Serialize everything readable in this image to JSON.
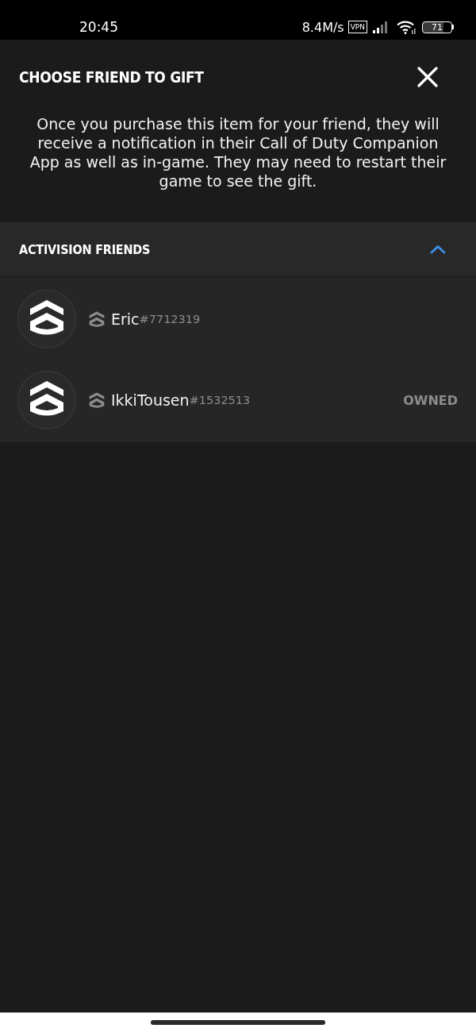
{
  "status_bar": {
    "time": "20:45",
    "network_speed": "8.4M/s",
    "vpn": "VPN",
    "battery": "71"
  },
  "dialog": {
    "title": "CHOOSE FRIEND TO GIFT",
    "description": "Once you purchase this item for your friend, they will receive a notification in their Call of Duty Companion App as well as in-game. They may need to restart their game to see the gift."
  },
  "section": {
    "title": "ACTIVISION FRIENDS",
    "expanded": true,
    "friends": [
      {
        "name": "Eric",
        "tag": "#7712319"
      },
      {
        "name": "IkkiTousen",
        "tag": "#1532513",
        "status": "OWNED"
      }
    ]
  }
}
